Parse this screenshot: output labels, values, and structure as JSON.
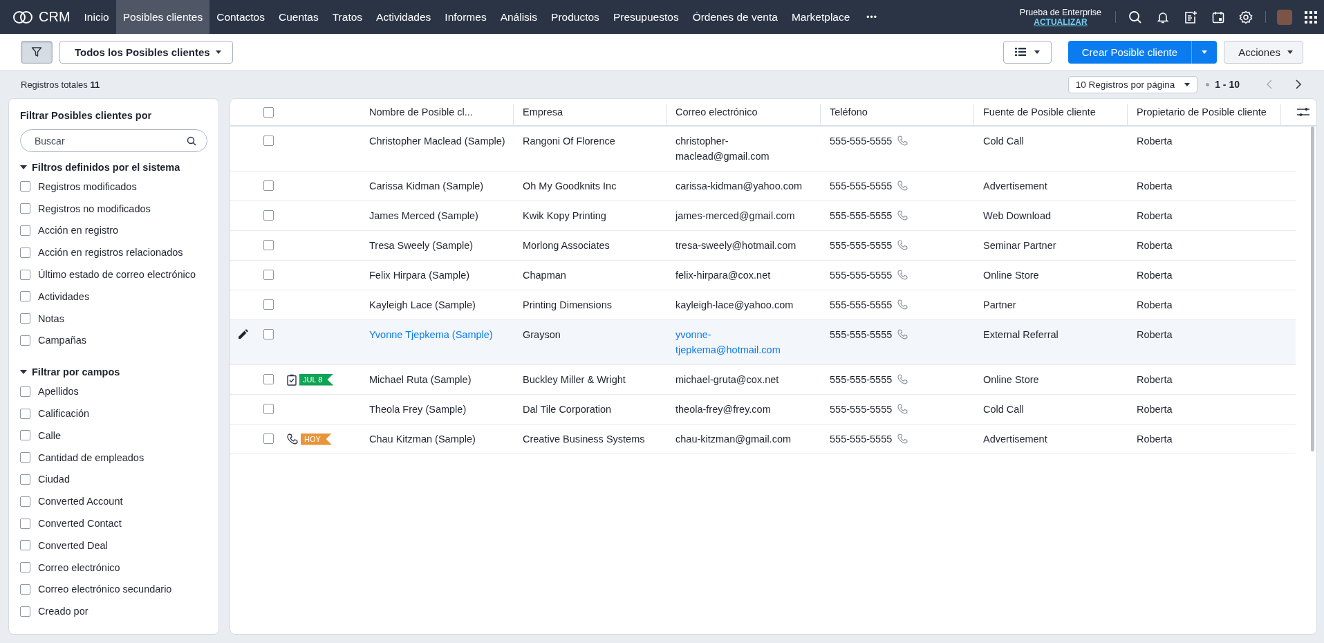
{
  "nav": {
    "brand": "CRM",
    "items": [
      {
        "label": "Inicio",
        "selected": false
      },
      {
        "label": "Posibles clientes",
        "selected": true
      },
      {
        "label": "Contactos",
        "selected": false
      },
      {
        "label": "Cuentas",
        "selected": false
      },
      {
        "label": "Tratos",
        "selected": false
      },
      {
        "label": "Actividades",
        "selected": false
      },
      {
        "label": "Informes",
        "selected": false
      },
      {
        "label": "Análisis",
        "selected": false
      },
      {
        "label": "Productos",
        "selected": false
      },
      {
        "label": "Presupuestos",
        "selected": false
      },
      {
        "label": "Órdenes de venta",
        "selected": false
      },
      {
        "label": "Marketplace",
        "selected": false
      }
    ],
    "more": "•••",
    "trial": "Prueba de Enterprise",
    "upgrade": "ACTUALIZAR"
  },
  "toolbar": {
    "filter_pressed": true,
    "view": "Todos los Posibles clientes",
    "create": "Crear Posible cliente",
    "actions": "Acciones"
  },
  "summary": {
    "total": "Registros totales **11**",
    "per_page": "10 Registros por página",
    "range": "1 - 10",
    "prev_disabled": true
  },
  "sidebar": {
    "title": "Filtrar Posibles clientes por",
    "search_placeholder": "Buscar",
    "sections": [
      {
        "title": "Filtros definidos por el sistema",
        "expanded": true,
        "items": [
          {
            "label": "Registros modificados",
            "checked": false
          },
          {
            "label": "Registros no modificados",
            "checked": false
          },
          {
            "label": "Acción en registro",
            "checked": false
          },
          {
            "label": "Acción en registros relacionados",
            "checked": false
          },
          {
            "label": "Último estado de correo electrónico",
            "checked": false
          },
          {
            "label": "Actividades",
            "checked": false
          },
          {
            "label": "Notas",
            "checked": false
          },
          {
            "label": "Campañas",
            "checked": false
          }
        ]
      },
      {
        "title": "Filtrar por campos",
        "expanded": true,
        "items": [
          {
            "label": "Apellidos",
            "checked": false
          },
          {
            "label": "Calificación",
            "checked": false
          },
          {
            "label": "Calle",
            "checked": false
          },
          {
            "label": "Cantidad de empleados",
            "checked": false
          },
          {
            "label": "Ciudad",
            "checked": false
          },
          {
            "label": "Converted Account",
            "checked": false
          },
          {
            "label": "Converted Contact",
            "checked": false
          },
          {
            "label": "Converted Deal",
            "checked": false
          },
          {
            "label": "Correo electrónico",
            "checked": false
          },
          {
            "label": "Correo electrónico secundario",
            "checked": false
          },
          {
            "label": "Creado por",
            "checked": false
          }
        ]
      }
    ]
  },
  "table": {
    "columns": [
      "Nombre de Posible cl...",
      "Empresa",
      "Correo electrónico",
      "Teléfono",
      "Fuente de Posible cliente",
      "Propietario de Posible cliente"
    ],
    "all_checked": false,
    "rows": [
      {
        "name": "Christopher Maclead (Sample)",
        "company": "Rangoni Of Florence",
        "email": "christopher-maclead@gmail.com",
        "phone": "555-555-5555",
        "source": "Cold Call",
        "owner": "Roberta",
        "checked": false,
        "hovered": false
      },
      {
        "name": "Carissa Kidman (Sample)",
        "company": "Oh My Goodknits Inc",
        "email": "carissa-kidman@yahoo.com",
        "phone": "555-555-5555",
        "source": "Advertisement",
        "owner": "Roberta",
        "checked": false,
        "hovered": false
      },
      {
        "name": "James Merced (Sample)",
        "company": "Kwik Kopy Printing",
        "email": "james-merced@gmail.com",
        "phone": "555-555-5555",
        "source": "Web Download",
        "owner": "Roberta",
        "checked": false,
        "hovered": false
      },
      {
        "name": "Tresa Sweely (Sample)",
        "company": "Morlong Associates",
        "email": "tresa-sweely@hotmail.com",
        "phone": "555-555-5555",
        "source": "Seminar Partner",
        "owner": "Roberta",
        "checked": false,
        "hovered": false
      },
      {
        "name": "Felix Hirpara (Sample)",
        "company": "Chapman",
        "email": "felix-hirpara@cox.net",
        "phone": "555-555-5555",
        "source": "Online Store",
        "owner": "Roberta",
        "checked": false,
        "hovered": false
      },
      {
        "name": "Kayleigh Lace (Sample)",
        "company": "Printing Dimensions",
        "email": "kayleigh-lace@yahoo.com",
        "phone": "555-555-5555",
        "source": "Partner",
        "owner": "Roberta",
        "checked": false,
        "hovered": false
      },
      {
        "name": "Yvonne Tjepkema (Sample)",
        "company": "Grayson",
        "email": "yvonne-tjepkema@hotmail.com",
        "phone": "555-555-5555",
        "source": "External Referral",
        "owner": "Roberta",
        "checked": false,
        "hovered": true
      },
      {
        "name": "Michael Ruta (Sample)",
        "company": "Buckley Miller & Wright",
        "email": "michael-gruta@cox.net",
        "phone": "555-555-5555",
        "source": "Online Store",
        "owner": "Roberta",
        "checked": false,
        "hovered": false,
        "activity": {
          "kind": "task",
          "label": "JUL 8",
          "color": "#10a255"
        }
      },
      {
        "name": "Theola Frey (Sample)",
        "company": "Dal Tile Corporation",
        "email": "theola-frey@frey.com",
        "phone": "555-555-5555",
        "source": "Cold Call",
        "owner": "Roberta",
        "checked": false,
        "hovered": false
      },
      {
        "name": "Chau Kitzman (Sample)",
        "company": "Creative Business Systems",
        "email": "chau-kitzman@gmail.com",
        "phone": "555-555-5555",
        "source": "Advertisement",
        "owner": "Roberta",
        "checked": false,
        "hovered": false,
        "activity": {
          "kind": "call",
          "label": "HOY",
          "color": "#e8953a"
        }
      }
    ]
  }
}
